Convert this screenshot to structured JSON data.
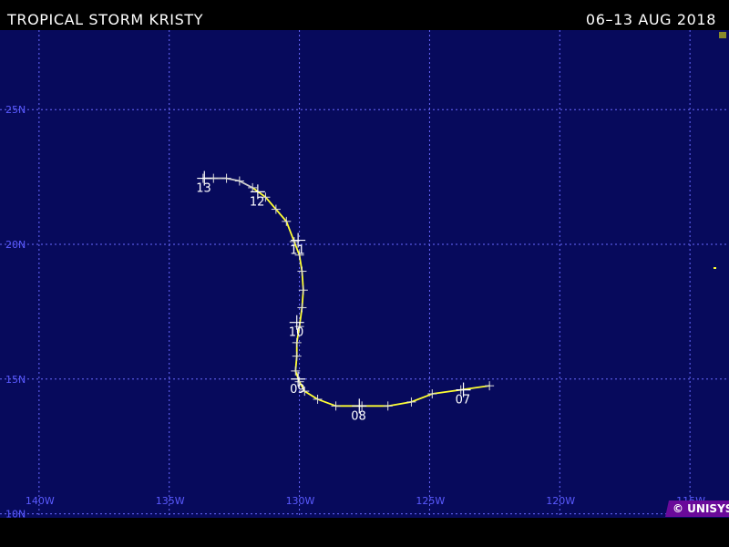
{
  "header": {
    "title": "TROPICAL STORM KRISTY",
    "date_range": "06–13 AUG 2018"
  },
  "credit": "© UNISYS",
  "colors": {
    "background": "#000000",
    "map": "#070a5c",
    "grid": "#6a6aff",
    "label": "#5a5aff",
    "track_storm": "#ffff33",
    "track_other": "#cccccc",
    "text": "#ffffff",
    "credit_bg": "#6a0a9a"
  },
  "map": {
    "lon_range": [
      -141.5,
      -113.5
    ],
    "lat_range": [
      9.85,
      27.95
    ],
    "lat_lines": [
      {
        "value": 25,
        "label": "25N"
      },
      {
        "value": 20,
        "label": "20N"
      },
      {
        "value": 15,
        "label": "15N"
      },
      {
        "value": 10,
        "label": "10N"
      }
    ],
    "lon_lines": [
      {
        "value": -140,
        "label": "140W"
      },
      {
        "value": -135,
        "label": "135W"
      },
      {
        "value": -130,
        "label": "130W"
      },
      {
        "value": -125,
        "label": "125W"
      },
      {
        "value": -120,
        "label": "120W"
      },
      {
        "value": -115,
        "label": "115W"
      }
    ]
  },
  "track": {
    "points": [
      {
        "lon": -122.7,
        "lat": 14.75,
        "cls": "storm"
      },
      {
        "lon": -123.8,
        "lat": 14.6,
        "cls": "storm"
      },
      {
        "lon": -124.9,
        "lat": 14.45,
        "cls": "storm"
      },
      {
        "lon": -125.7,
        "lat": 14.15,
        "cls": "storm"
      },
      {
        "lon": -126.6,
        "lat": 14.0,
        "cls": "storm"
      },
      {
        "lon": -127.6,
        "lat": 14.0,
        "cls": "storm"
      },
      {
        "lon": -128.6,
        "lat": 14.0,
        "cls": "storm"
      },
      {
        "lon": -129.3,
        "lat": 14.25,
        "cls": "storm"
      },
      {
        "lon": -129.8,
        "lat": 14.55,
        "cls": "storm"
      },
      {
        "lon": -130.0,
        "lat": 14.9,
        "cls": "storm"
      },
      {
        "lon": -130.15,
        "lat": 15.3,
        "cls": "storm"
      },
      {
        "lon": -130.1,
        "lat": 15.85,
        "cls": "storm"
      },
      {
        "lon": -130.1,
        "lat": 16.35,
        "cls": "storm"
      },
      {
        "lon": -130.0,
        "lat": 16.95,
        "cls": "storm"
      },
      {
        "lon": -129.9,
        "lat": 17.65,
        "cls": "storm"
      },
      {
        "lon": -129.85,
        "lat": 18.3,
        "cls": "storm"
      },
      {
        "lon": -129.9,
        "lat": 19.0,
        "cls": "storm"
      },
      {
        "lon": -130.0,
        "lat": 19.6,
        "cls": "storm"
      },
      {
        "lon": -130.2,
        "lat": 20.1,
        "cls": "storm"
      },
      {
        "lon": -130.5,
        "lat": 20.85,
        "cls": "storm"
      },
      {
        "lon": -130.9,
        "lat": 21.3,
        "cls": "storm"
      },
      {
        "lon": -131.3,
        "lat": 21.75,
        "cls": "storm"
      },
      {
        "lon": -131.8,
        "lat": 22.1,
        "cls": "storm"
      },
      {
        "lon": -132.3,
        "lat": 22.35,
        "cls": "other"
      },
      {
        "lon": -132.8,
        "lat": 22.45,
        "cls": "other"
      },
      {
        "lon": -133.3,
        "lat": 22.45,
        "cls": "other"
      },
      {
        "lon": -133.7,
        "lat": 22.45,
        "cls": "other"
      }
    ],
    "day_marks": [
      {
        "label": "07",
        "lon": -123.7,
        "lat": 14.6
      },
      {
        "label": "08",
        "lon": -127.7,
        "lat": 14.0
      },
      {
        "label": "09",
        "lon": -130.05,
        "lat": 15.0
      },
      {
        "label": "10",
        "lon": -130.1,
        "lat": 17.1
      },
      {
        "label": "11",
        "lon": -130.05,
        "lat": 20.15
      },
      {
        "label": "12",
        "lon": -131.6,
        "lat": 21.95
      },
      {
        "label": "13",
        "lon": -133.65,
        "lat": 22.45
      }
    ]
  }
}
